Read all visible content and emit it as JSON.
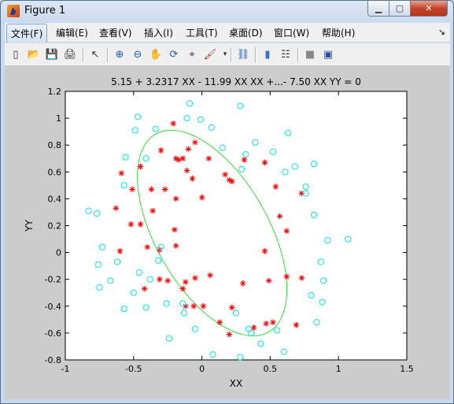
{
  "window": {
    "title": "Figure 1",
    "min_symbol": "▁",
    "max_symbol": "▢",
    "close_symbol": "✕"
  },
  "menu": {
    "items": [
      "文件(F)",
      "编辑(E)",
      "查看(V)",
      "插入(I)",
      "工具(T)",
      "桌面(D)",
      "窗口(W)",
      "帮助(H)"
    ],
    "dock_arrow": "↘"
  },
  "toolbar": {
    "icons": [
      "new-figure-icon",
      "open-file-icon",
      "save-icon",
      "print-icon",
      "pointer-icon",
      "zoom-in-icon",
      "zoom-out-icon",
      "pan-icon",
      "rotate-icon",
      "data-cursor-icon",
      "brush-icon",
      "link-plot-icon",
      "colorbar-icon",
      "legend-icon",
      "hide-plot-tools-icon",
      "show-plot-tools-icon"
    ],
    "glyphs": [
      "▯",
      "📂",
      "💾",
      "🖨",
      "↖",
      "⊕",
      "⊖",
      "✋",
      "⟳",
      "⌖",
      "🖌",
      "⛓",
      "▮",
      "☷",
      "■",
      "▣"
    ]
  },
  "plot": {
    "title": "5.15 + 3.2317 XX  - 11.99 XX XX +...- 7.50 XX YY = 0",
    "xlabel": "XX",
    "ylabel": "YY",
    "marker_colors": {
      "positive": "#ff0000",
      "negative": "#00e5ee",
      "boundary": "#33dd33"
    }
  },
  "chart_data": {
    "type": "scatter",
    "title": "5.15 + 3.2317 XX  - 11.99 XX XX +...- 7.50 XX YY = 0",
    "xlabel": "XX",
    "ylabel": "YY",
    "xlim": [
      -1,
      1.5
    ],
    "ylim": [
      -0.8,
      1.2
    ],
    "xticks": [
      "-1",
      "-0.5",
      "0",
      "0.5",
      "1",
      "1.5"
    ],
    "yticks": [
      "1.2",
      "1",
      "0.8",
      "0.6",
      "0.4",
      "0.2",
      "0",
      "-0.2",
      "-0.4",
      "-0.6",
      "-0.8"
    ],
    "grid": false,
    "series": [
      {
        "marker": "star",
        "color": "#ff0000",
        "points": [
          [
            -0.21,
            0.96
          ],
          [
            -0.3,
            0.76
          ],
          [
            -0.05,
            0.82
          ],
          [
            -0.1,
            0.77
          ],
          [
            -0.19,
            0.7
          ],
          [
            -0.17,
            0.69
          ],
          [
            -0.14,
            0.7
          ],
          [
            -0.11,
            0.61
          ],
          [
            -0.45,
            0.64
          ],
          [
            -0.07,
            0.55
          ],
          [
            0.05,
            0.7
          ],
          [
            0.17,
            0.58
          ],
          [
            0.2,
            0.54
          ],
          [
            0.22,
            0.53
          ],
          [
            0.31,
            0.69
          ],
          [
            0.46,
            0.67
          ],
          [
            0.54,
            0.49
          ],
          [
            -0.59,
            0.59
          ],
          [
            -0.51,
            0.47
          ],
          [
            -0.37,
            0.47
          ],
          [
            -0.27,
            0.47
          ],
          [
            -0.36,
            0.31
          ],
          [
            -0.19,
            0.4
          ],
          [
            0.0,
            0.41
          ],
          [
            -0.63,
            0.33
          ],
          [
            -0.52,
            0.21
          ],
          [
            -0.45,
            0.21
          ],
          [
            -0.4,
            0.04
          ],
          [
            -0.31,
            0.02
          ],
          [
            -0.2,
            0.17
          ],
          [
            -0.19,
            0.05
          ],
          [
            -0.6,
            0.01
          ],
          [
            0.57,
            0.27
          ],
          [
            0.62,
            0.16
          ],
          [
            0.46,
            0.01
          ],
          [
            -0.31,
            -0.2
          ],
          [
            -0.25,
            -0.21
          ],
          [
            -0.12,
            -0.22
          ],
          [
            -0.05,
            -0.19
          ],
          [
            0.06,
            -0.17
          ],
          [
            0.3,
            -0.23
          ],
          [
            0.49,
            -0.21
          ],
          [
            0.62,
            -0.18
          ],
          [
            0.73,
            -0.19
          ],
          [
            -0.42,
            -0.27
          ],
          [
            -0.14,
            -0.27
          ],
          [
            -0.12,
            -0.4
          ],
          [
            -0.06,
            -0.4
          ],
          [
            0.01,
            -0.4
          ],
          [
            0.22,
            -0.41
          ],
          [
            0.13,
            -0.52
          ],
          [
            0.2,
            -0.61
          ],
          [
            0.38,
            -0.56
          ],
          [
            0.47,
            -0.53
          ],
          [
            0.52,
            -0.52
          ],
          [
            0.69,
            -0.54
          ],
          [
            0.73,
            0.44
          ]
        ]
      },
      {
        "marker": "circle",
        "color": "#00e5ee",
        "points": [
          [
            -0.49,
            0.91
          ],
          [
            -0.47,
            1.01
          ],
          [
            -0.34,
            0.92
          ],
          [
            -0.09,
            1.11
          ],
          [
            -0.11,
            1.0
          ],
          [
            -0.01,
            0.99
          ],
          [
            0.07,
            0.93
          ],
          [
            0.28,
            1.09
          ],
          [
            -0.56,
            0.71
          ],
          [
            -0.41,
            0.7
          ],
          [
            0.15,
            0.78
          ],
          [
            0.32,
            0.73
          ],
          [
            0.39,
            0.82
          ],
          [
            0.52,
            0.75
          ],
          [
            0.63,
            0.89
          ],
          [
            -0.57,
            0.5
          ],
          [
            0.29,
            0.62
          ],
          [
            0.61,
            0.6
          ],
          [
            0.68,
            0.64
          ],
          [
            0.82,
            0.66
          ],
          [
            0.76,
            0.49
          ],
          [
            -0.83,
            0.31
          ],
          [
            -0.77,
            0.29
          ],
          [
            0.82,
            0.28
          ],
          [
            0.76,
            0.44
          ],
          [
            0.92,
            0.09
          ],
          [
            1.07,
            0.1
          ],
          [
            -0.76,
            -0.09
          ],
          [
            -0.73,
            0.04
          ],
          [
            -0.62,
            -0.07
          ],
          [
            0.87,
            -0.07
          ],
          [
            -0.75,
            -0.26
          ],
          [
            -0.67,
            -0.21
          ],
          [
            -0.5,
            -0.3
          ],
          [
            -0.46,
            -0.15
          ],
          [
            -0.38,
            -0.2
          ],
          [
            -0.32,
            -0.06
          ],
          [
            -0.3,
            0.04
          ],
          [
            0.8,
            -0.32
          ],
          [
            0.89,
            -0.21
          ],
          [
            -0.57,
            -0.42
          ],
          [
            -0.41,
            -0.41
          ],
          [
            -0.26,
            -0.38
          ],
          [
            -0.14,
            -0.38
          ],
          [
            -0.13,
            -0.45
          ],
          [
            -0.05,
            -0.57
          ],
          [
            0.25,
            -0.45
          ],
          [
            0.34,
            -0.57
          ],
          [
            0.43,
            -0.68
          ],
          [
            0.55,
            -0.58
          ],
          [
            0.88,
            -0.37
          ],
          [
            0.84,
            -0.52
          ],
          [
            0.6,
            -0.74
          ],
          [
            0.08,
            -0.76
          ],
          [
            0.28,
            -0.78
          ],
          [
            -0.24,
            -0.64
          ],
          [
            0.36,
            -0.6
          ]
        ]
      }
    ],
    "curve": {
      "type": "ellipse",
      "color": "#33dd33",
      "center": [
        0.075,
        0.145
      ],
      "semi_axes": [
        0.845,
        0.415
      ],
      "rotation_deg": -61
    }
  }
}
